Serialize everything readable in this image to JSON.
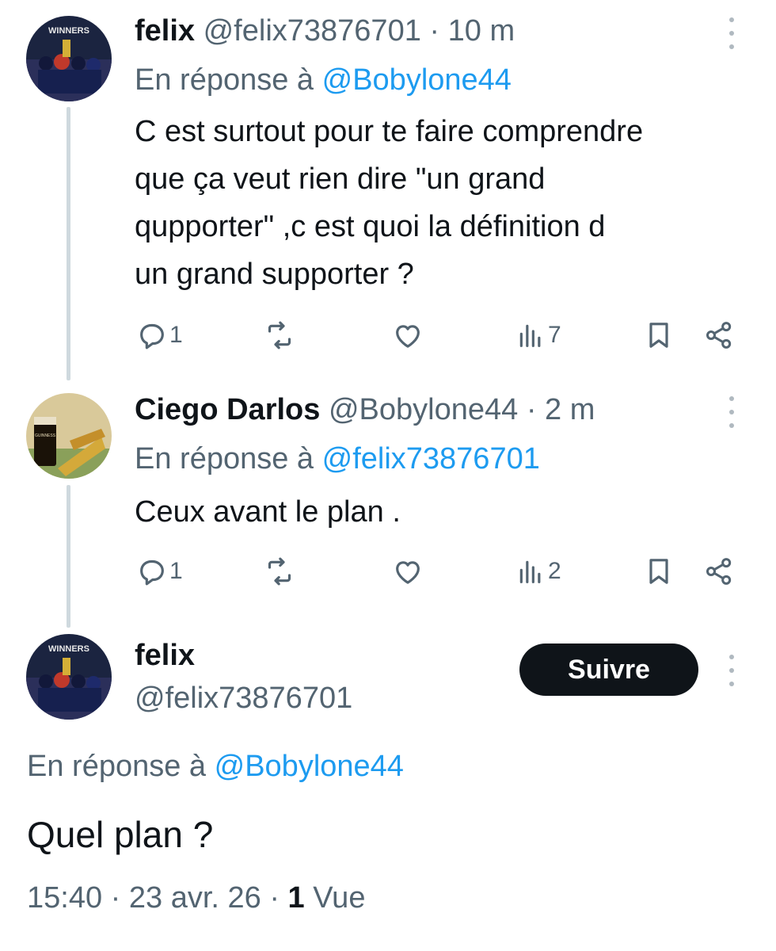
{
  "tweets": [
    {
      "name": "felix",
      "handle": "@felix73876701",
      "time": "· 10 m",
      "reply_prefix": "En réponse à",
      "reply_to": "@Bobylone44",
      "text": "C est surtout pour te faire comprendre\nque ça veut rien dire \"un grand\nqupporter\" ,c est quoi la définition d\nun grand supporter ?",
      "replies": "1",
      "views": "7"
    },
    {
      "name": "Ciego Darlos",
      "handle": "@Bobylone44",
      "time": "· 2 m",
      "reply_prefix": "En réponse à",
      "reply_to": "@felix73876701",
      "text": "Ceux avant le plan .",
      "replies": "1",
      "views": "2",
      "avatar_text": "GUINNESS"
    }
  ],
  "main_tweet": {
    "name": "felix",
    "handle": "@felix73876701",
    "follow_label": "Suivre",
    "reply_prefix": "En réponse à",
    "reply_to": "@Bobylone44",
    "text": "Quel plan ?",
    "timestamp": "15:40 · 23 avr. 26 ·",
    "view_count": "1",
    "view_label": "Vue"
  },
  "avatar_badge": "WINNERS",
  "colors": {
    "text": "#0f1419",
    "muted": "#536471",
    "link": "#1d9bf0",
    "thread_line": "#cfd9de",
    "follow_bg": "#0f1419"
  },
  "icons": [
    "reply-icon",
    "retweet-icon",
    "like-icon",
    "views-icon",
    "bookmark-icon",
    "share-icon",
    "more-icon"
  ]
}
